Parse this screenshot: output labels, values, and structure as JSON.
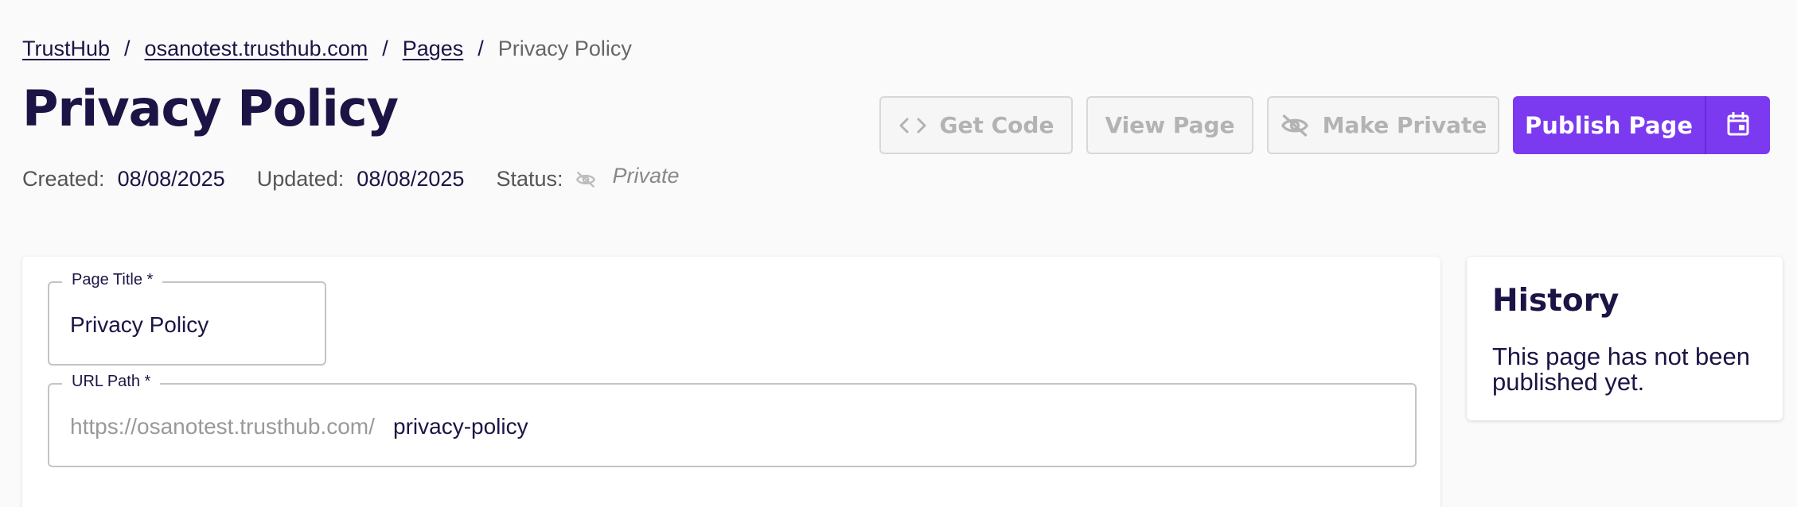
{
  "breadcrumb": {
    "items": [
      "TrustHub",
      "osanotest.trusthub.com",
      "Pages"
    ],
    "separator": "/",
    "current": "Privacy Policy"
  },
  "page": {
    "title": "Privacy Policy"
  },
  "meta": {
    "created_label": "Created:",
    "created_value": "08/08/2025",
    "updated_label": "Updated:",
    "updated_value": "08/08/2025",
    "status_label": "Status:",
    "status_value": "Private",
    "status_icon": "eye-off-icon"
  },
  "toolbar": {
    "get_code_label": "Get Code",
    "get_code_icon": "code-icon",
    "view_page_label": "View Page",
    "make_private_label": "Make Private",
    "make_private_icon": "eye-off-icon",
    "publish_label": "Publish Page",
    "schedule_icon": "calendar-icon"
  },
  "form": {
    "page_title_label": "Page Title *",
    "page_title_value": "Privacy Policy",
    "url_path_label": "URL Path *",
    "url_prefix": "https://osanotest.trusthub.com/",
    "url_path_value": "privacy-policy"
  },
  "history": {
    "title": "History",
    "message": "This page has not been published yet."
  },
  "colors": {
    "primary": "#7b3af0",
    "text": "#1c1445",
    "muted": "#888888",
    "disabled": "#b3b3b3",
    "background": "#fafafa"
  }
}
